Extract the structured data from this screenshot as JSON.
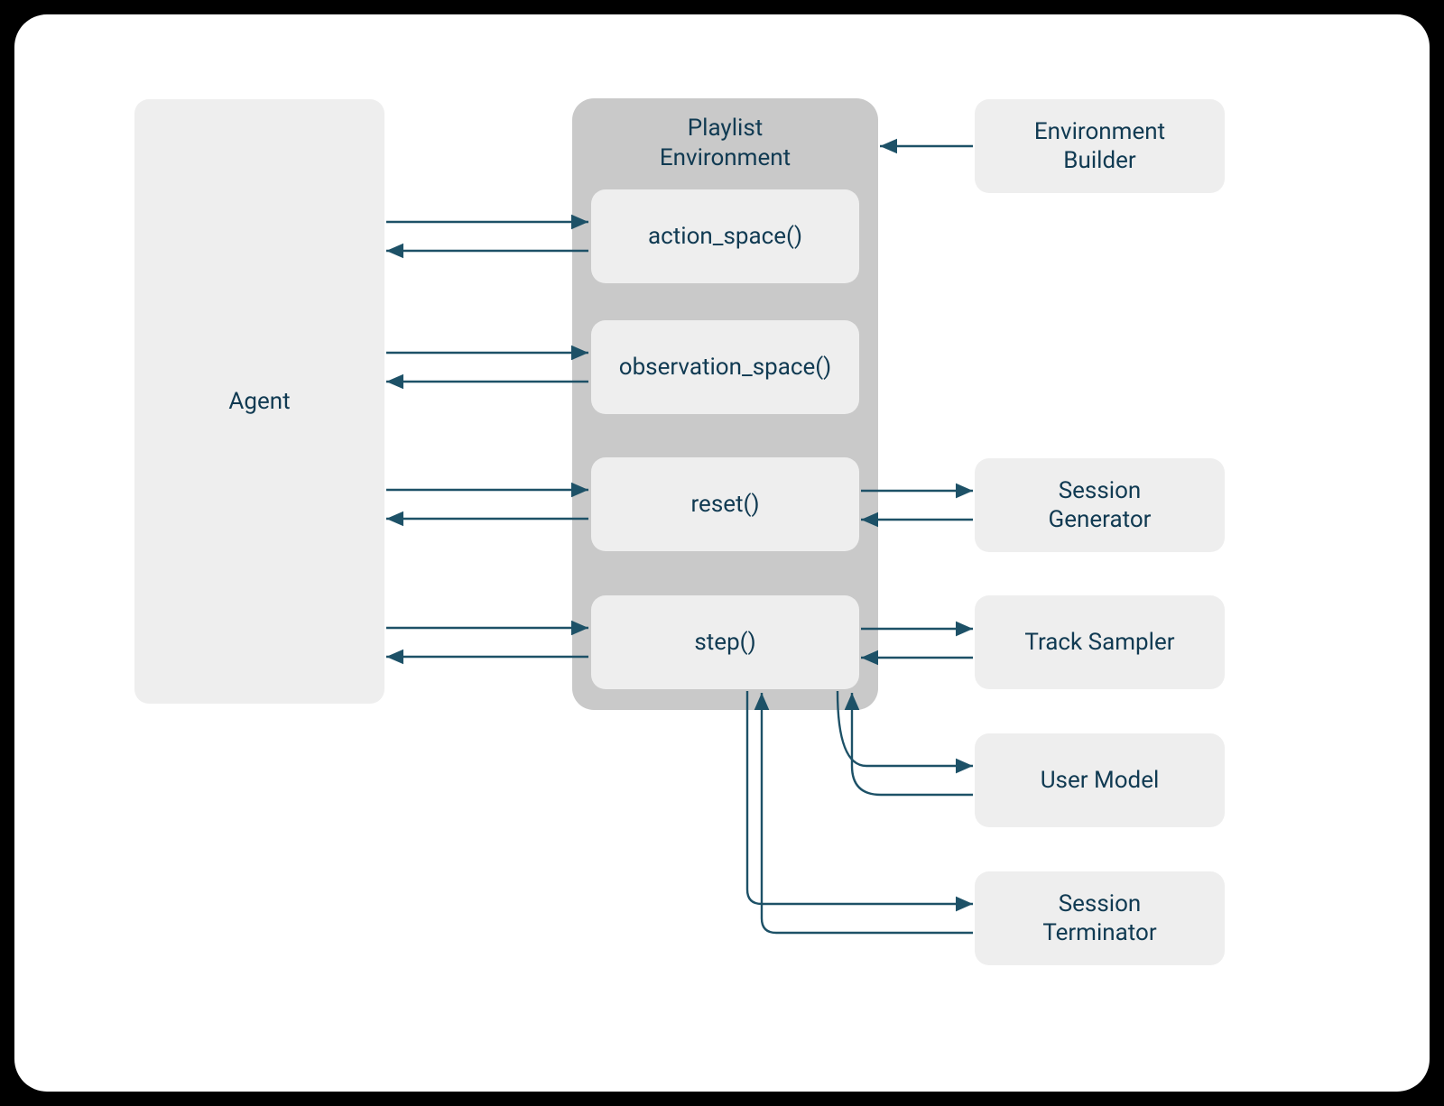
{
  "colors": {
    "stroke": "#1d5167",
    "text": "#103a52",
    "light_fill": "#eeeeee",
    "container_fill": "#c9c9c9",
    "card_bg": "#ffffff",
    "page_bg": "#000000"
  },
  "nodes": {
    "agent": {
      "label": "Agent"
    },
    "playlist_env": {
      "label": "Playlist\nEnvironment"
    },
    "action_space": {
      "label": "action_space()"
    },
    "observation_space": {
      "label": "observation_space()"
    },
    "reset": {
      "label": "reset()"
    },
    "step": {
      "label": "step()"
    },
    "environment_builder": {
      "label": "Environment\nBuilder"
    },
    "session_generator": {
      "label": "Session\nGenerator"
    },
    "track_sampler": {
      "label": "Track Sampler"
    },
    "user_model": {
      "label": "User Model"
    },
    "session_terminator": {
      "label": "Session\nTerminator"
    }
  },
  "edges": [
    {
      "from": "agent",
      "to": "action_space",
      "bidirectional": true
    },
    {
      "from": "agent",
      "to": "observation_space",
      "bidirectional": true
    },
    {
      "from": "agent",
      "to": "reset",
      "bidirectional": true
    },
    {
      "from": "agent",
      "to": "step",
      "bidirectional": true
    },
    {
      "from": "environment_builder",
      "to": "playlist_env",
      "bidirectional": false
    },
    {
      "from": "reset",
      "to": "session_generator",
      "bidirectional": true
    },
    {
      "from": "step",
      "to": "track_sampler",
      "bidirectional": true
    },
    {
      "from": "step",
      "to": "user_model",
      "bidirectional": true
    },
    {
      "from": "step",
      "to": "session_terminator",
      "bidirectional": true
    }
  ]
}
